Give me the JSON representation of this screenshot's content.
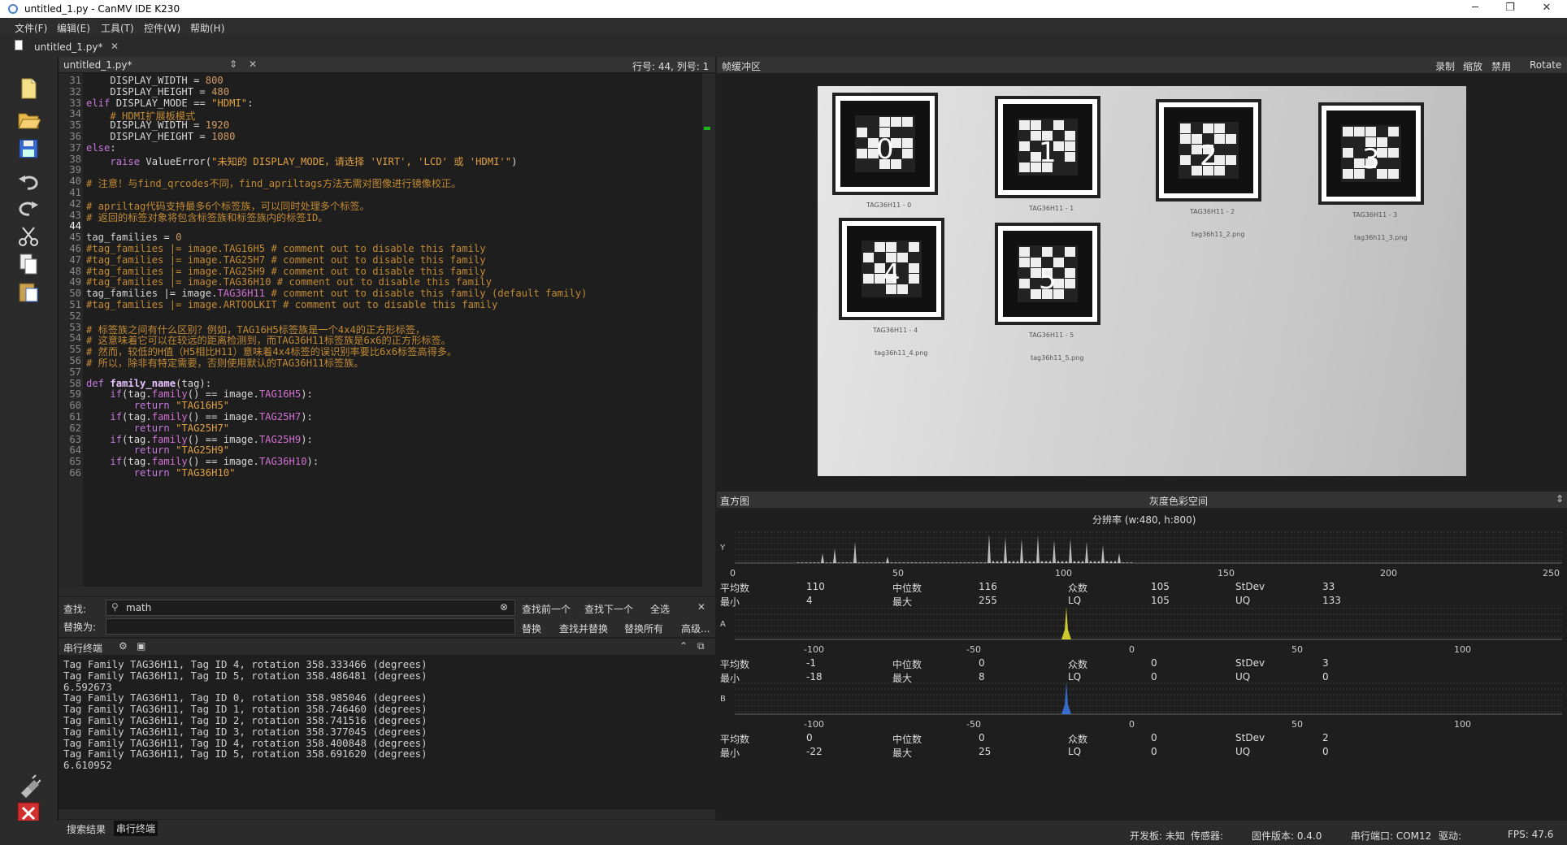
{
  "window": {
    "title": "untitled_1.py - CanMV IDE K230"
  },
  "menu": [
    "文件(F)",
    "编辑(E)",
    "工具(T)",
    "控件(W)",
    "帮助(H)"
  ],
  "file_tab": {
    "label": "untitled_1.py*"
  },
  "editor": {
    "filename": "untitled_1.py*",
    "cursor": "行号: 44, 列号: 1",
    "lines": [
      {
        "n": "31",
        "code": "    DISPLAY_WIDTH = 800"
      },
      {
        "n": "32",
        "code": "    DISPLAY_HEIGHT = 480"
      },
      {
        "n": "33",
        "code": "elif DISPLAY_MODE == \"HDMI\":"
      },
      {
        "n": "34",
        "code": "    # HDMI扩展板模式"
      },
      {
        "n": "35",
        "code": "    DISPLAY_WIDTH = 1920"
      },
      {
        "n": "36",
        "code": "    DISPLAY_HEIGHT = 1080"
      },
      {
        "n": "37",
        "code": "else:"
      },
      {
        "n": "38",
        "code": "    raise ValueError(\"未知的 DISPLAY_MODE，请选择 'VIRT', 'LCD' 或 'HDMI'\")"
      },
      {
        "n": "39",
        "code": ""
      },
      {
        "n": "40",
        "code": "# 注意！与find_qrcodes不同，find_apriltags方法无需对图像进行镜像校正。"
      },
      {
        "n": "41",
        "code": ""
      },
      {
        "n": "42",
        "code": "# apriltag代码支持最多6个标签族，可以同时处理多个标签。"
      },
      {
        "n": "43",
        "code": "# 返回的标签对象将包含标签族和标签族内的标签ID。"
      },
      {
        "n": "44",
        "code": ""
      },
      {
        "n": "45",
        "code": "tag_families = 0"
      },
      {
        "n": "46",
        "code": "#tag_families |= image.TAG16H5 # comment out to disable this family"
      },
      {
        "n": "47",
        "code": "#tag_families |= image.TAG25H7 # comment out to disable this family"
      },
      {
        "n": "48",
        "code": "#tag_families |= image.TAG25H9 # comment out to disable this family"
      },
      {
        "n": "49",
        "code": "#tag_families |= image.TAG36H10 # comment out to disable this family"
      },
      {
        "n": "50",
        "code": "tag_families |= image.TAG36H11 # comment out to disable this family (default family)"
      },
      {
        "n": "51",
        "code": "#tag_families |= image.ARTOOLKIT # comment out to disable this family"
      },
      {
        "n": "52",
        "code": ""
      },
      {
        "n": "53",
        "code": "# 标签族之间有什么区别？例如，TAG16H5标签族是一个4x4的正方形标签，"
      },
      {
        "n": "54",
        "code": "# 这意味着它可以在较远的距离检测到，而TAG36H11标签族是6x6的正方形标签。"
      },
      {
        "n": "55",
        "code": "# 然而，较低的H值（H5相比H11）意味着4x4标签的误识别率要比6x6标签高得多。"
      },
      {
        "n": "56",
        "code": "# 所以，除非有特定需要，否则使用默认的TAG36H11标签族。"
      },
      {
        "n": "57",
        "code": ""
      },
      {
        "n": "58",
        "code": "def family_name(tag):"
      },
      {
        "n": "59",
        "code": "    if(tag.family() == image.TAG16H5):"
      },
      {
        "n": "60",
        "code": "        return \"TAG16H5\""
      },
      {
        "n": "61",
        "code": "    if(tag.family() == image.TAG25H7):"
      },
      {
        "n": "62",
        "code": "        return \"TAG25H7\""
      },
      {
        "n": "63",
        "code": "    if(tag.family() == image.TAG25H9):"
      },
      {
        "n": "64",
        "code": "        return \"TAG25H9\""
      },
      {
        "n": "65",
        "code": "    if(tag.family() == image.TAG36H10):"
      },
      {
        "n": "66",
        "code": "        return \"TAG36H10\""
      }
    ]
  },
  "find": {
    "label": "查找:",
    "value": "math",
    "replace_label": "替换为:",
    "prev": "查找前一个",
    "next": "查找下一个",
    "all": "全选",
    "replace": "替换",
    "find_replace": "查找并替换",
    "replace_all": "替换所有",
    "advanced": "高级..."
  },
  "terminal": {
    "title": "串行终端",
    "lines": [
      "Tag Family TAG36H11, Tag ID 4, rotation 358.333466 (degrees)",
      "Tag Family TAG36H11, Tag ID 5, rotation 358.486481 (degrees)",
      "6.592673",
      "Tag Family TAG36H11, Tag ID 0, rotation 358.985046 (degrees)",
      "Tag Family TAG36H11, Tag ID 1, rotation 358.746460 (degrees)",
      "Tag Family TAG36H11, Tag ID 2, rotation 358.741516 (degrees)",
      "Tag Family TAG36H11, Tag ID 3, rotation 358.377045 (degrees)",
      "Tag Family TAG36H11, Tag ID 4, rotation 358.400848 (degrees)",
      "Tag Family TAG36H11, Tag ID 5, rotation 358.691620 (degrees)",
      "6.610952"
    ]
  },
  "bottom_tabs": [
    "搜索结果",
    "串行终端"
  ],
  "framebuffer": {
    "title": "帧缓冲区",
    "actions": [
      "录制",
      "缩放",
      "禁用",
      "Rotate"
    ],
    "tags": [
      {
        "num": "0",
        "label": "TAG36H11 - 0",
        "file": "tag36h11_0.png"
      },
      {
        "num": "1",
        "label": "TAG36H11 - 1",
        "file": "tag36h11_1.png"
      },
      {
        "num": "2",
        "label": "TAG36H11 - 2",
        "file": "tag36h11_2.png"
      },
      {
        "num": "3",
        "label": "TAG36H11 - 3",
        "file": "tag36h11_3.png"
      },
      {
        "num": "4",
        "label": "TAG36H11 - 4",
        "file": "tag36h11_4.png"
      },
      {
        "num": "5",
        "label": "TAG36H11 - 5",
        "file": "tag36h11_5.png"
      }
    ]
  },
  "histogram": {
    "title": "直方图",
    "colorspace": "灰度色彩空间",
    "resolution": "分辨率 (w:480, h:800)",
    "stat_labels": {
      "mean": "平均数",
      "median": "中位数",
      "mode": "众数",
      "stdev": "StDev",
      "min": "最小",
      "max": "最大",
      "lq": "LQ",
      "uq": "UQ"
    },
    "channels": [
      {
        "axis": "Y",
        "ticks": [
          "0",
          "50",
          "100",
          "150",
          "200",
          "250"
        ],
        "color": "#d8d8d8",
        "stats": {
          "mean": "110",
          "median": "116",
          "mode": "105",
          "stdev": "33",
          "min": "4",
          "max": "255",
          "lq": "105",
          "uq": "133"
        }
      },
      {
        "axis": "A",
        "ticks": [
          "-100",
          "-50",
          "0",
          "50",
          "100"
        ],
        "color": "#e8e830",
        "stats": {
          "mean": "-1",
          "median": "0",
          "mode": "0",
          "stdev": "3",
          "min": "-18",
          "max": "8",
          "lq": "0",
          "uq": "0"
        }
      },
      {
        "axis": "B",
        "ticks": [
          "-100",
          "-50",
          "0",
          "50",
          "100"
        ],
        "color": "#3a7ae8",
        "stats": {
          "mean": "0",
          "median": "0",
          "mode": "0",
          "stdev": "2",
          "min": "-22",
          "max": "25",
          "lq": "0",
          "uq": "0"
        }
      }
    ]
  },
  "status": {
    "board": "开发板: 未知",
    "sensor": "传感器:",
    "firmware": "固件版本: 0.4.0",
    "port": "串行端口: COM12",
    "driver": "驱动:",
    "fps": "FPS: 47.6"
  }
}
